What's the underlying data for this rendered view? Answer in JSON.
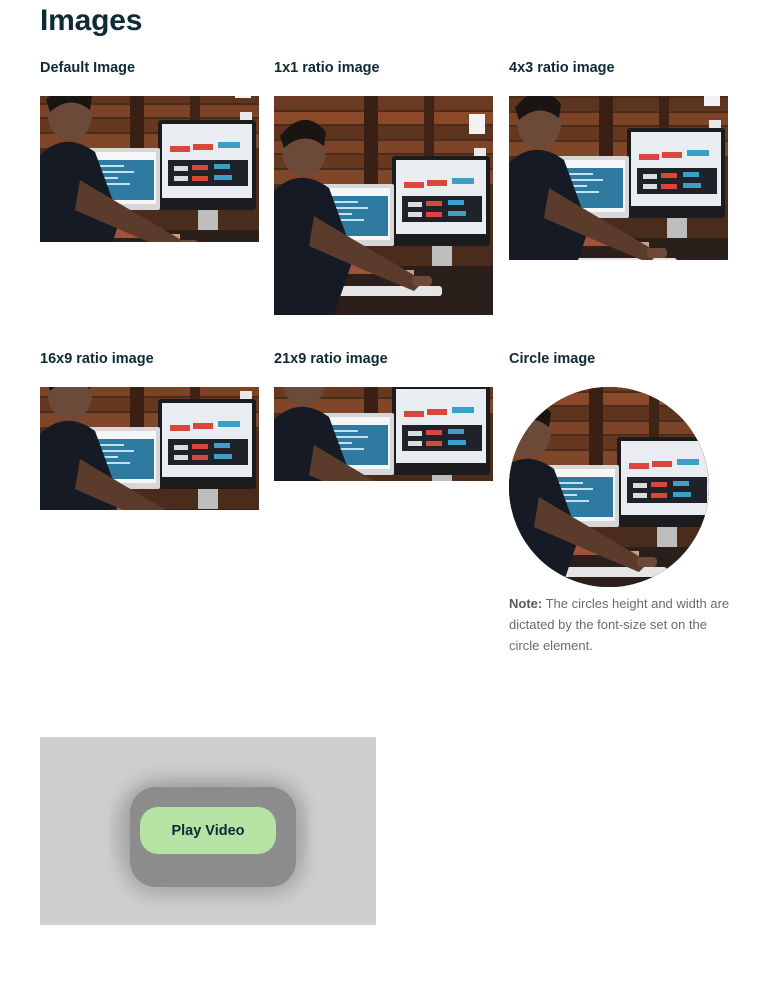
{
  "page": {
    "title": "Images"
  },
  "images": [
    {
      "title": "Default Image"
    },
    {
      "title": "1x1 ratio image"
    },
    {
      "title": "4x3 ratio image"
    },
    {
      "title": "16x9 ratio image"
    },
    {
      "title": "21x9 ratio image"
    },
    {
      "title": "Circle image"
    }
  ],
  "note": {
    "label": "Note:",
    "text": " The circles height and width are dictated by the font-size set on the circle element."
  },
  "video": {
    "button_label": "Play Video"
  },
  "colors": {
    "heading": "#0e2a33",
    "play_button": "#b4e3a3",
    "video_bg": "#cfcfcf"
  }
}
